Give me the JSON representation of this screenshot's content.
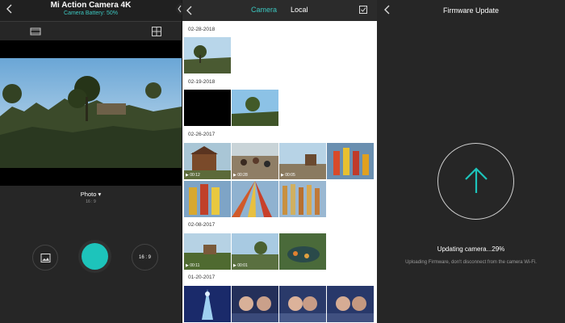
{
  "colors": {
    "accent": "#1dc4bb",
    "dark_bg": "#262626",
    "header_bg": "#2b2b2b"
  },
  "camera_screen": {
    "title": "Mi Action Camera 4K",
    "battery": "Camera Battery: 50%",
    "mode_label": "Photo ▾",
    "mode_ratio": "16 : 9",
    "ratio_button": "16 : 9",
    "icons": {
      "back": "chevron-left-icon",
      "tool_left": "film-strip-icon",
      "tool_right": "grid-icon",
      "gallery": "image-icon"
    }
  },
  "gallery_screen": {
    "tabs": [
      "Camera",
      "Local"
    ],
    "active_tab": "Camera",
    "icons": {
      "back": "chevron-left-icon",
      "select": "checkbox-icon"
    },
    "groups": [
      {
        "date": "02-28-2018",
        "items": [
          {
            "kind": "photo"
          }
        ]
      },
      {
        "date": "02-19-2018",
        "items": [
          {
            "kind": "photo"
          },
          {
            "kind": "photo"
          }
        ]
      },
      {
        "date": "02-26-2017",
        "items": [
          {
            "kind": "video",
            "duration": "00:12"
          },
          {
            "kind": "video",
            "duration": "00:28"
          },
          {
            "kind": "video",
            "duration": "00:05"
          },
          {
            "kind": "photo"
          },
          {
            "kind": "photo"
          },
          {
            "kind": "photo"
          },
          {
            "kind": "photo"
          }
        ]
      },
      {
        "date": "02-08-2017",
        "items": [
          {
            "kind": "video",
            "duration": "00:11"
          },
          {
            "kind": "video",
            "duration": "00:01"
          },
          {
            "kind": "photo"
          }
        ]
      },
      {
        "date": "01-20-2017",
        "items": [
          {
            "kind": "photo"
          },
          {
            "kind": "photo"
          },
          {
            "kind": "photo"
          },
          {
            "kind": "photo"
          }
        ]
      }
    ]
  },
  "firmware_screen": {
    "title": "Firmware Update",
    "status": "Updating camera...29%",
    "progress_percent": 29,
    "note": "Uploading Firmware, don't disconnect from the camera Wi-Fi.",
    "icons": {
      "back": "chevron-left-icon",
      "upload": "arrow-up-icon"
    }
  }
}
